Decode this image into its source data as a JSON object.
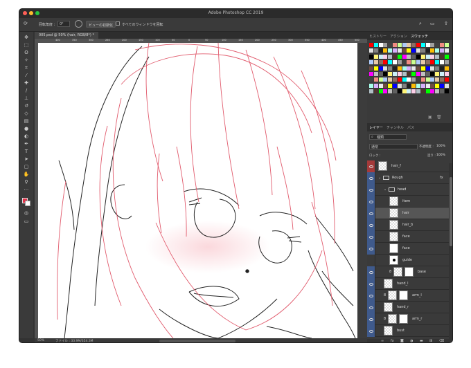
{
  "window": {
    "title": "Adobe Photoshop CC 2019"
  },
  "options": {
    "rotate_label": "回転角度 :",
    "rotate_value": "0°",
    "reset_view": "ビューの初期化",
    "all_windows": "すべてのウィンドウを回転"
  },
  "document": {
    "tab": "005.psd @ 50% (hair, RGB/8*) *"
  },
  "rulers": {
    "h": [
      "400",
      "350",
      "300",
      "250",
      "200",
      "150",
      "100",
      "50",
      "0",
      "50",
      "100",
      "150",
      "200",
      "250",
      "300",
      "350",
      "400",
      "450",
      "500",
      "550"
    ]
  },
  "status": {
    "zoom": "50%",
    "file": "ファイル : 33.9M/354.3M"
  },
  "colors": {
    "fg": "#e0334a",
    "bg": "#ffffff",
    "accent": "#3f5a8c"
  },
  "panels": {
    "top_tabs": [
      "ヒストリー",
      "アクション",
      "スウォッチ"
    ],
    "layer_tabs": [
      "レイヤー",
      "チャンネル",
      "パス"
    ],
    "filter_label": "種類",
    "blend_mode": "通常",
    "opacity_label": "不透明度 :",
    "opacity_value": "100%",
    "lock_label": "ロック :",
    "fill_label": "塗り :",
    "fill_value": "100%"
  },
  "layers": [
    {
      "name": "hair_f",
      "eye": "red",
      "indent": 0,
      "type": "raster"
    },
    {
      "name": "Rough",
      "eye": "on",
      "indent": 0,
      "type": "group",
      "fx": "fx"
    },
    {
      "name": "head",
      "eye": "on",
      "indent": 1,
      "type": "group"
    },
    {
      "name": "item",
      "eye": "on",
      "indent": 2,
      "type": "raster"
    },
    {
      "name": "hair",
      "eye": "on",
      "indent": 2,
      "type": "raster",
      "selected": true
    },
    {
      "name": "hair_b",
      "eye": "on",
      "indent": 2,
      "type": "raster"
    },
    {
      "name": "face",
      "eye": "on",
      "indent": 2,
      "type": "raster"
    },
    {
      "name": "face",
      "eye": "on",
      "indent": 2,
      "type": "plain"
    },
    {
      "name": "guide",
      "eye": "off",
      "indent": 2,
      "type": "guide"
    },
    {
      "name": "base",
      "eye": "on",
      "indent": 2,
      "type": "mask"
    },
    {
      "name": "hand_l",
      "eye": "on",
      "indent": 1,
      "type": "raster"
    },
    {
      "name": "arm_l",
      "eye": "on",
      "indent": 1,
      "type": "mask"
    },
    {
      "name": "hand_r",
      "eye": "on",
      "indent": 1,
      "type": "raster"
    },
    {
      "name": "arm_r",
      "eye": "on",
      "indent": 1,
      "type": "mask"
    },
    {
      "name": "bust",
      "eye": "on",
      "indent": 1,
      "type": "raster"
    }
  ],
  "tools": [
    "move-icon",
    "marquee-icon",
    "lasso-icon",
    "magic-wand-icon",
    "crop-icon",
    "eyedropper-icon",
    "healing-icon",
    "brush-icon",
    "stamp-icon",
    "history-brush-icon",
    "eraser-icon",
    "gradient-icon",
    "blur-icon",
    "dodge-icon",
    "pen-icon",
    "type-icon",
    "path-select-icon",
    "shape-icon",
    "hand-icon",
    "zoom-icon",
    "more-icon"
  ]
}
